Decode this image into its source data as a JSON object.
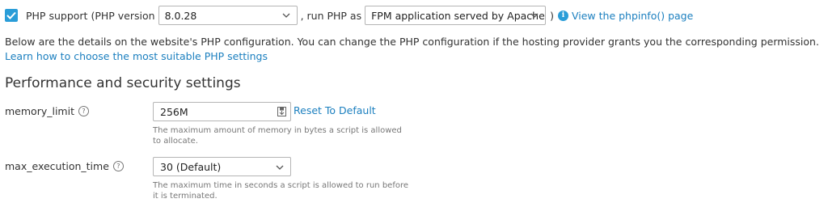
{
  "php_row": {
    "checkbox_checked": true,
    "support_label": "PHP support",
    "version_prefix": "(PHP version",
    "version_selected": "8.0.28",
    "run_as_label": ", run PHP as",
    "handler_selected": "FPM application served by Apache",
    "close_paren": ")",
    "phpinfo_link": "View the phpinfo() page"
  },
  "description": {
    "text": "Below are the details on the website's PHP configuration. You can change the PHP configuration if the hosting provider grants you the corresponding permission.",
    "link": "Learn how to choose the most suitable PHP settings"
  },
  "section": {
    "title": "Performance and security settings"
  },
  "fields": {
    "memory_limit": {
      "label": "memory_limit",
      "value": "256M",
      "reset_link": "Reset To Default",
      "hint": "The maximum amount of memory in bytes a script is allowed to allocate."
    },
    "max_execution_time": {
      "label": "max_execution_time",
      "value": "30 (Default)",
      "hint": "The maximum time in seconds a script is allowed to run before it is terminated."
    }
  },
  "colors": {
    "accent": "#2a9dd8",
    "link": "#1b7fbf",
    "text": "#333333",
    "hint": "#777777"
  }
}
